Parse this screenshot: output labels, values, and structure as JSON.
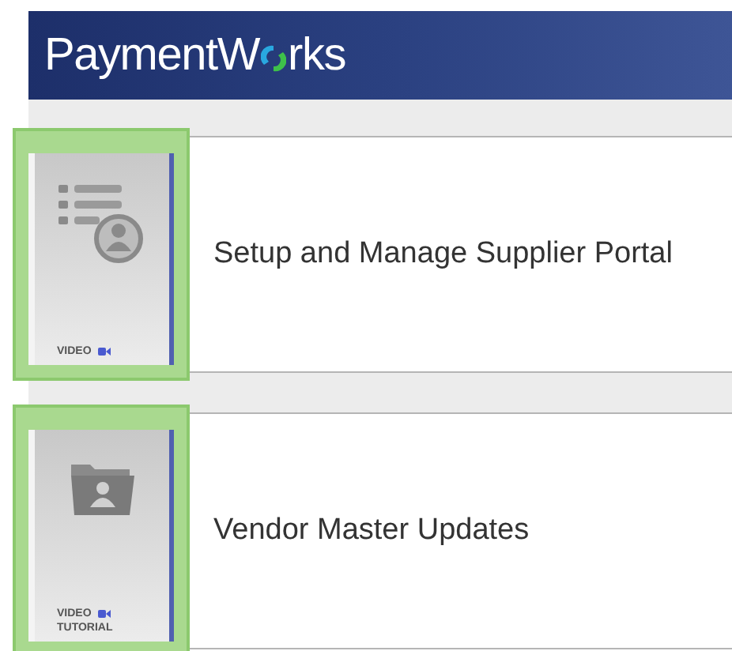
{
  "header": {
    "logo_before": "PaymentW",
    "logo_after": "rks"
  },
  "items": [
    {
      "title": "Setup and Manage Supplier Portal",
      "kind": "list",
      "caption": [
        "VIDEO"
      ]
    },
    {
      "title": "Vendor Master Updates",
      "kind": "folder",
      "caption": [
        "VIDEO",
        "TUTORIAL"
      ]
    }
  ]
}
